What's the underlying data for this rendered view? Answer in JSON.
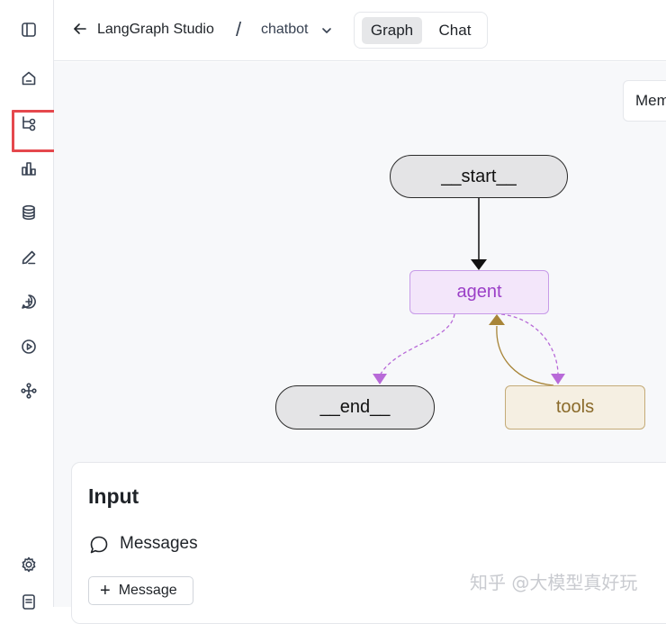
{
  "header": {
    "app_title": "LangGraph Studio",
    "separator": "/",
    "graph_name": "chatbot",
    "tabs": [
      {
        "label": "Graph",
        "active": true
      },
      {
        "label": "Chat",
        "active": false
      }
    ]
  },
  "sidebar": {
    "icons": [
      "sidebar-toggle-icon",
      "home-icon",
      "graph-icon",
      "bar-chart-icon",
      "database-icon",
      "pen-icon",
      "add-chat-icon",
      "play-icon",
      "network-icon",
      "gear-icon",
      "document-icon"
    ],
    "highlight_color": "#e5484d"
  },
  "canvas": {
    "memory_button_label": "Memory",
    "nodes": {
      "start": "__start__",
      "agent": "agent",
      "end": "__end__",
      "tools": "tools"
    },
    "colors": {
      "agent_border": "#c79be8",
      "agent_text": "#9b3fc7",
      "tools_border": "#c4ab78",
      "tools_text": "#8a6a2a",
      "conditional_edge": "#b86ad8",
      "tools_edge": "#a88538"
    }
  },
  "input": {
    "title": "Input",
    "messages_label": "Messages",
    "add_message_label": "Message"
  },
  "watermark": "知乎 @大模型真好玩"
}
